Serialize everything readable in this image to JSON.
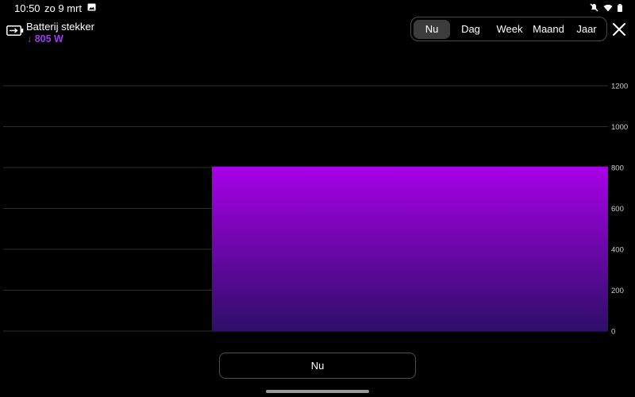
{
  "status_bar": {
    "time": "10:50",
    "date": "zo 9 mrt",
    "icons": [
      "gallery-icon",
      "mute-icon",
      "wifi-icon",
      "battery-status-icon"
    ]
  },
  "device": {
    "name": "Batterij stekker",
    "power": "↓ 805 W",
    "icon": "battery-charging-icon",
    "accent_color": "#9a3ee8"
  },
  "period_tabs": {
    "items": [
      "Nu",
      "Dag",
      "Week",
      "Maand",
      "Jaar"
    ],
    "selected": "Nu"
  },
  "close_icon": "close-icon",
  "chart_data": {
    "type": "bar",
    "categories": [
      "Nu"
    ],
    "values": [
      805
    ],
    "ylim": [
      0,
      1200
    ],
    "yticks": [
      0,
      200,
      400,
      600,
      800,
      1000,
      1200
    ],
    "grid": true,
    "colors": {
      "bar_top": "#a800e8",
      "bar_bottom": "#2e0e68",
      "grid": "#2c2c2c"
    }
  },
  "bottom_button": {
    "label": "Nu"
  }
}
